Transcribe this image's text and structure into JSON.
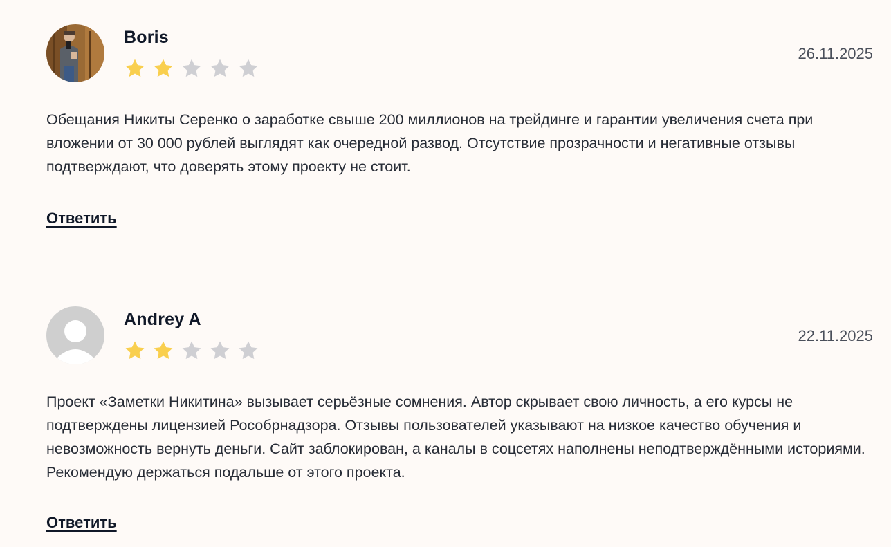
{
  "reviews": [
    {
      "author": "Boris",
      "rating": 2,
      "max_rating": 5,
      "date": "26.11.2025",
      "avatar": "photo-avatar",
      "text": "Обещания Никиты Серенко о заработке свыше 200 миллионов на трейдинге и гарантии увеличения счета при вложении от 30 000 рублей выглядят как очередной развод. Отсутствие прозрачности и негативные отзывы подтверждают, что доверять этому проекту не стоит.",
      "reply_label": "Ответить"
    },
    {
      "author": "Andrey A",
      "rating": 2,
      "max_rating": 5,
      "date": "22.11.2025",
      "avatar": "default-user-avatar",
      "text": "Проект «Заметки Никитина» вызывает серьёзные сомнения. Автор скрывает свою личность, а его курсы не подтверждены лицензией Рособрнадзора. Отзывы пользователей указывают на низкое качество обучения и невозможность вернуть деньги. Сайт заблокирован, а каналы в соцсетях наполнены неподтверждёнными историями. Рекомендую держаться подальше от этого проекта.",
      "reply_label": "Ответить"
    }
  ],
  "colors": {
    "background": "#fefaf7",
    "star_filled": "#f9cf4e",
    "star_empty": "#cfcfd3",
    "author": "#101828",
    "text": "#272c36",
    "date": "#4a4f5a"
  }
}
